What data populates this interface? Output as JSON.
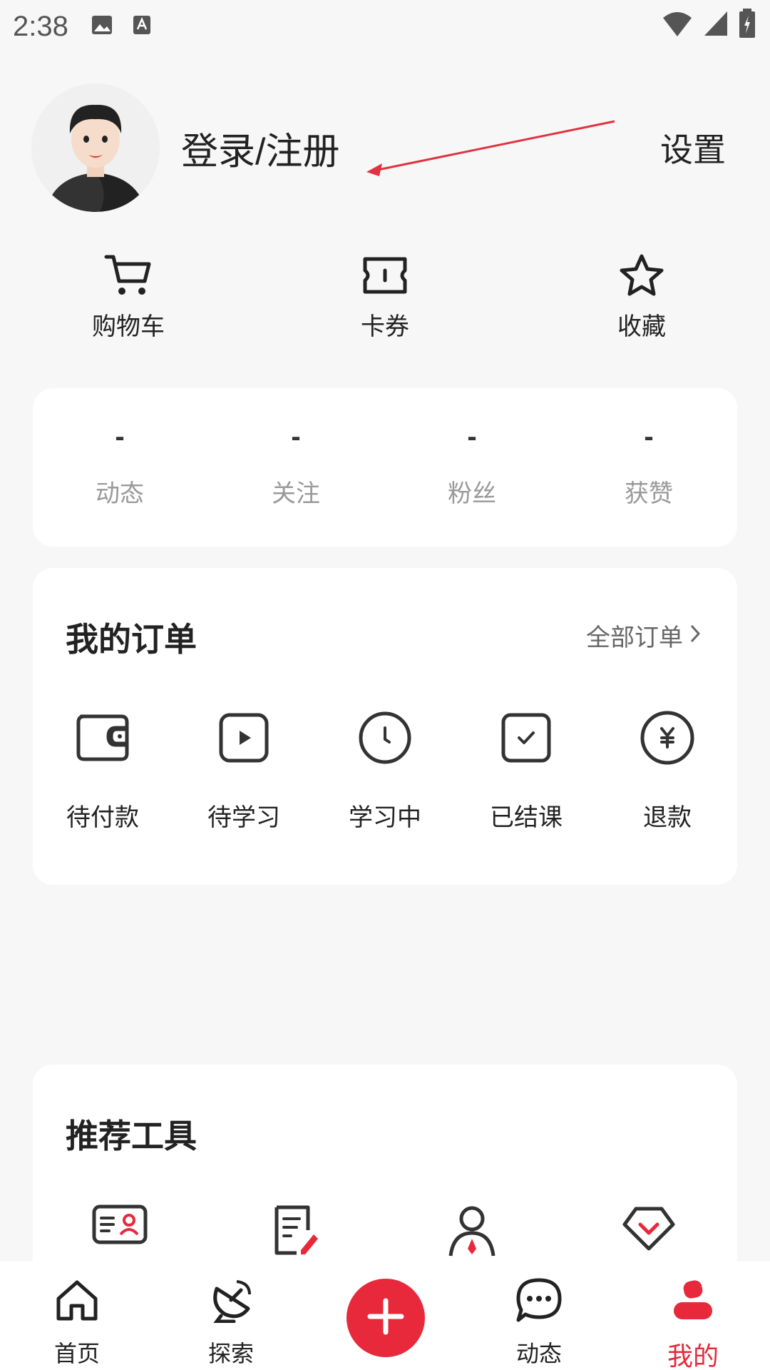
{
  "status_bar": {
    "time": "2:38"
  },
  "profile": {
    "login_text": "登录/注册",
    "settings_label": "设置"
  },
  "quick_actions": [
    {
      "label": "购物车",
      "icon": "cart-icon"
    },
    {
      "label": "卡券",
      "icon": "coupon-icon"
    },
    {
      "label": "收藏",
      "icon": "star-icon"
    }
  ],
  "stats": [
    {
      "value": "-",
      "label": "动态"
    },
    {
      "value": "-",
      "label": "关注"
    },
    {
      "value": "-",
      "label": "粉丝"
    },
    {
      "value": "-",
      "label": "获赞"
    }
  ],
  "orders": {
    "title": "我的订单",
    "all_label": "全部订单",
    "items": [
      {
        "label": "待付款",
        "icon": "wallet-icon"
      },
      {
        "label": "待学习",
        "icon": "play-icon"
      },
      {
        "label": "学习中",
        "icon": "clock-icon"
      },
      {
        "label": "已结课",
        "icon": "check-box-icon"
      },
      {
        "label": "退款",
        "icon": "yen-icon"
      }
    ]
  },
  "tools": {
    "title": "推荐工具",
    "items": [
      {
        "icon": "id-card-icon"
      },
      {
        "icon": "edit-note-icon"
      },
      {
        "icon": "person-tie-icon"
      },
      {
        "icon": "heart-check-icon"
      }
    ]
  },
  "tabbar": {
    "items": [
      {
        "label": "首页",
        "icon": "home-icon"
      },
      {
        "label": "探索",
        "icon": "satellite-icon"
      },
      {
        "label": "",
        "icon": "plus-icon"
      },
      {
        "label": "动态",
        "icon": "chat-icon"
      },
      {
        "label": "我的",
        "icon": "user-icon"
      }
    ]
  },
  "colors": {
    "accent": "#e8283b",
    "background": "#f7f7f7",
    "card": "#ffffff",
    "muted_text": "#999999"
  }
}
